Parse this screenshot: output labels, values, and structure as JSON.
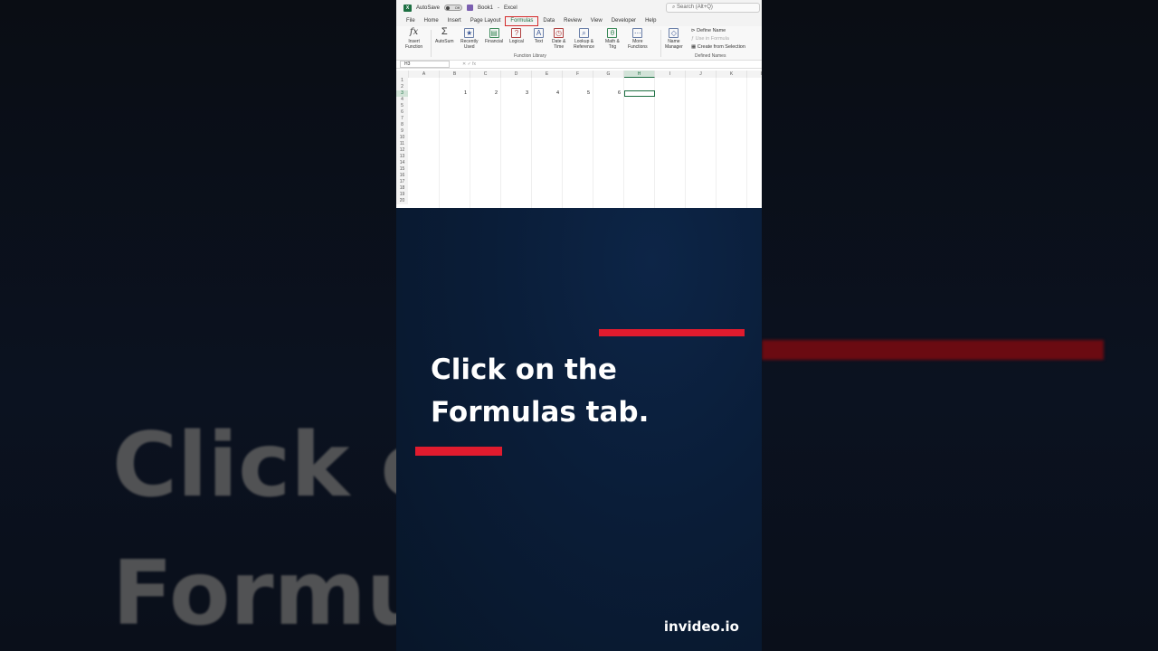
{
  "background": {
    "line1": "Click o",
    "line2": "Formu"
  },
  "excel": {
    "titlebar": {
      "autosave_label": "AutoSave",
      "toggle_state": "Off",
      "filename": "Book1",
      "separator": "-",
      "app_name": "Excel",
      "search_placeholder": "Search (Alt+Q)"
    },
    "menu": [
      "File",
      "Home",
      "Insert",
      "Page Layout",
      "Formulas",
      "Data",
      "Review",
      "View",
      "Developer",
      "Help"
    ],
    "active_menu": "Formulas",
    "ribbon": {
      "insert_function": [
        "Insert",
        "Function"
      ],
      "autosum": "AutoSum",
      "recently_used": [
        "Recently",
        "Used"
      ],
      "financial": "Financial",
      "logical": "Logical",
      "text": "Text",
      "date_time": [
        "Date &",
        "Time"
      ],
      "lookup_reference": [
        "Lookup &",
        "Reference"
      ],
      "math_trig": [
        "Math &",
        "Trig"
      ],
      "more_functions": [
        "More",
        "Functions"
      ],
      "function_library_label": "Function Library",
      "name_manager": [
        "Name",
        "Manager"
      ],
      "define_name": "Define Name",
      "use_in_formula": "Use in Formula",
      "create_from_selection": "Create from Selection",
      "defined_names_label": "Defined Names"
    },
    "name_box": "H3",
    "columns": [
      "A",
      "B",
      "C",
      "D",
      "E",
      "F",
      "G",
      "H",
      "I",
      "J",
      "K",
      "L"
    ],
    "selected_column": "H",
    "rows": [
      "1",
      "2",
      "3",
      "4",
      "5",
      "6",
      "7",
      "8",
      "9",
      "10",
      "11",
      "12",
      "13",
      "14",
      "15",
      "16",
      "17",
      "18",
      "19",
      "20"
    ],
    "selected_row": "3",
    "row3_values": [
      "1",
      "2",
      "3",
      "4",
      "5",
      "6"
    ]
  },
  "caption": {
    "line1": "Click on the",
    "line2": "Formulas tab."
  },
  "watermark": "invideo.io",
  "colors": {
    "accent_red": "#e01b2e",
    "excel_green": "#1d6f42",
    "panel_navy": "#0a1d38"
  }
}
